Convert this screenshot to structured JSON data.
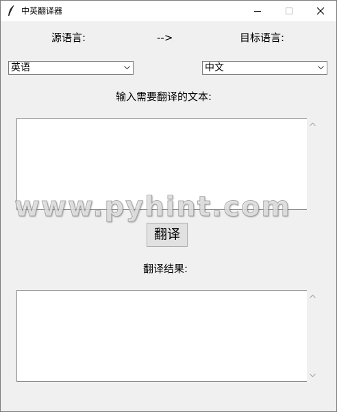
{
  "window": {
    "title": "中英翻译器",
    "icon": "feather-icon",
    "controls": [
      "minimize-icon",
      "maximize-icon",
      "close-icon"
    ]
  },
  "languages": {
    "source_label": "源语言:",
    "arrow": "-->",
    "target_label": "目标语言:",
    "source_value": "英语",
    "target_value": "中文"
  },
  "input": {
    "label": "输入需要翻译的文本:",
    "text": ""
  },
  "translate_button": "翻译",
  "result": {
    "label": "翻译结果:",
    "text": ""
  },
  "watermark": "www.pyhint.com"
}
